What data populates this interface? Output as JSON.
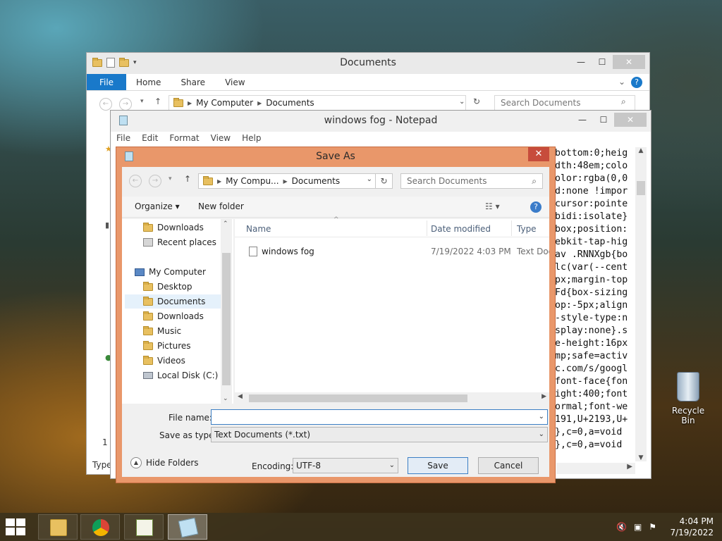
{
  "explorer": {
    "title": "Documents",
    "ribbon": {
      "file": "File",
      "home": "Home",
      "share": "Share",
      "view": "View",
      "help": "?"
    },
    "path": [
      "My Computer",
      "Documents"
    ],
    "search_placeholder": "Search Documents",
    "status_left": "1 i",
    "status_partial": "Type"
  },
  "notepad": {
    "title": "windows fog - Notepad",
    "menu": [
      "File",
      "Edit",
      "Format",
      "View",
      "Help"
    ],
    "text_lines": [
      "bottom:0;heig",
      "dth:48em;colo",
      "olor:rgba(0,0",
      "d:none !impor",
      "cursor:pointe",
      "bidi:isolate}",
      "box;position:",
      "ebkit-tap-hig",
      "av .RNNXgb{bo",
      "lc(var(--cent",
      "px;margin-top",
      "Fd{box-sizing",
      "op:-5px;align",
      "-style-type:n",
      "splay:none}.s",
      "e-height:16px",
      "mp;safe=activ",
      "c.com/s/googl",
      "font-face{fon",
      "ight:400;font",
      "ormal;font-we",
      "191,U+2193,U+",
      "},c=0,a=void",
      "},c=0,a=void"
    ]
  },
  "saveas": {
    "title": "Save As",
    "close": "✕",
    "path": [
      "My Compu...",
      "Documents"
    ],
    "search_placeholder": "Search Documents",
    "toolbar": {
      "organize": "Organize ▾",
      "new_folder": "New folder",
      "help": "?"
    },
    "tree": {
      "top_items": [
        "Downloads",
        "Recent places"
      ],
      "my_computer": "My Computer",
      "children": [
        "Desktop",
        "Documents",
        "Downloads",
        "Music",
        "Pictures",
        "Videos",
        "Local Disk (C:)"
      ],
      "selected": "Documents"
    },
    "columns": {
      "name": "Name",
      "date": "Date modified",
      "type": "Type"
    },
    "files": [
      {
        "name": "windows fog",
        "date": "7/19/2022 4:03 PM",
        "type": "Text Document"
      }
    ],
    "file_name_label": "File name:",
    "file_name_value": "",
    "save_type_label": "Save as type:",
    "save_type_value": "Text Documents (*.txt)",
    "hide_folders": "Hide Folders",
    "encoding_label": "Encoding:",
    "encoding_value": "UTF-8",
    "save_button": "Save",
    "cancel_button": "Cancel"
  },
  "desktop": {
    "recycle_bin": "Recycle Bin"
  },
  "taskbar": {
    "time": "4:04 PM",
    "date": "7/19/2022"
  },
  "colors": {
    "dialog_frame": "#e9976a",
    "accent": "#1979ca",
    "close_red": "#c74c3c"
  }
}
